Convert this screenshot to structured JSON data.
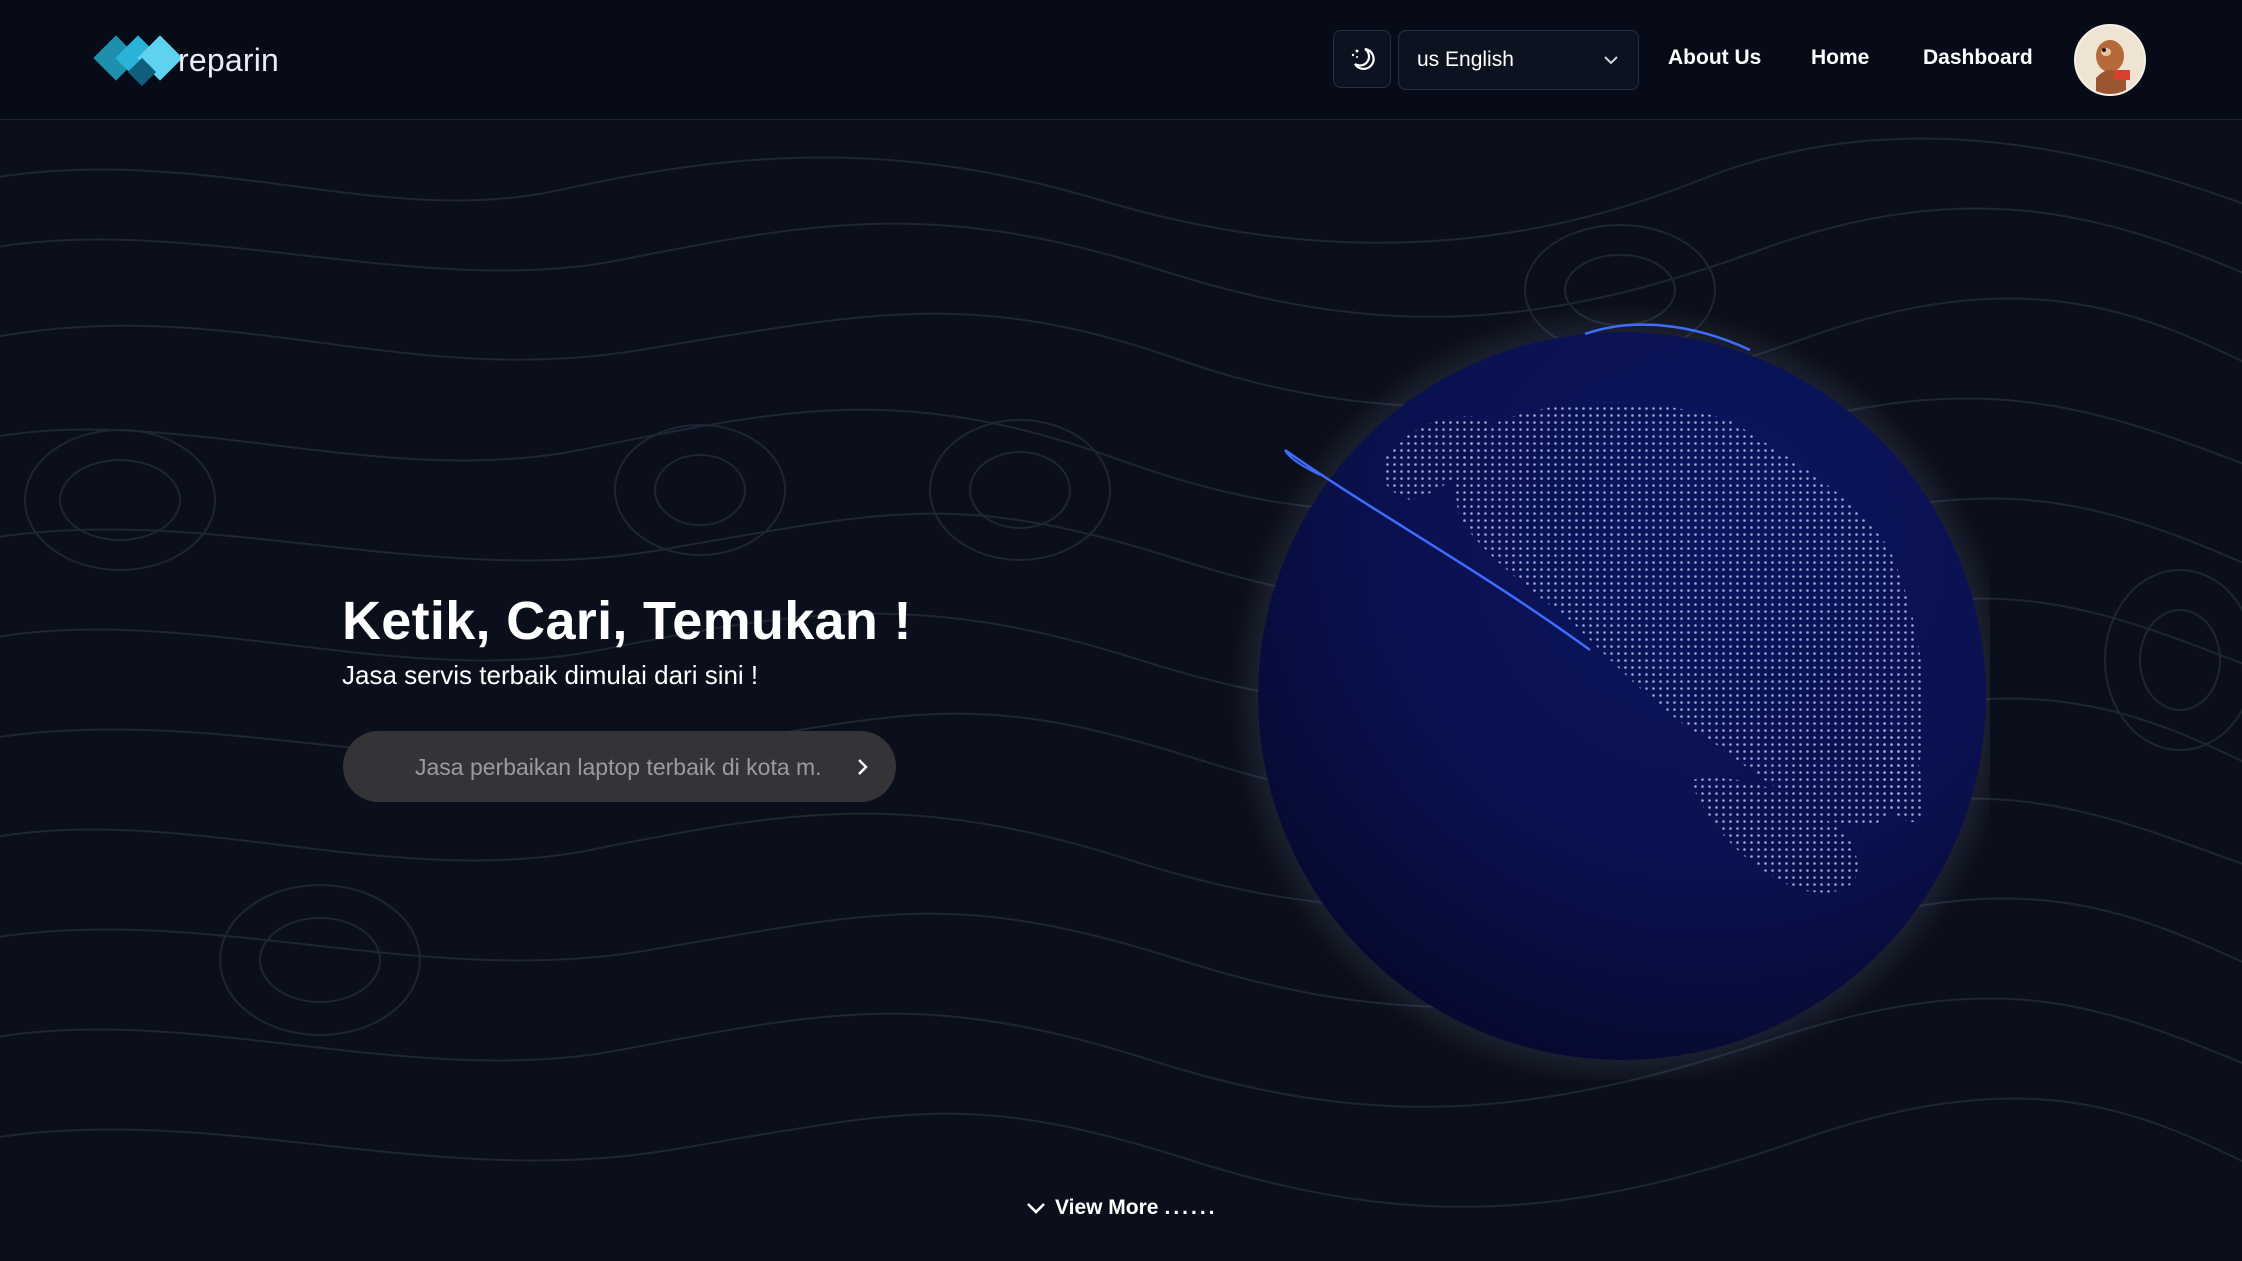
{
  "brand": {
    "name": "reparin"
  },
  "header": {
    "language": {
      "selected": "us English"
    },
    "nav": {
      "about": "About Us",
      "home": "Home",
      "dashboard": "Dashboard"
    },
    "theme_toggle_icon": "moon-sun-icon"
  },
  "hero": {
    "title": "Ketik, Cari, Temukan !",
    "subtitle": "Jasa servis terbaik dimulai dari sini !",
    "search": {
      "placeholder": "Jasa perbaikan laptop terbaik di kota m.",
      "value": ""
    }
  },
  "footer": {
    "view_more_label": "View More",
    "view_more_dots": "......"
  },
  "colors": {
    "background": "#0b0f1b",
    "navbar": "#070b17",
    "globe": "#0d1450",
    "arc": "#3d6cff",
    "search_bg": "#343438"
  }
}
